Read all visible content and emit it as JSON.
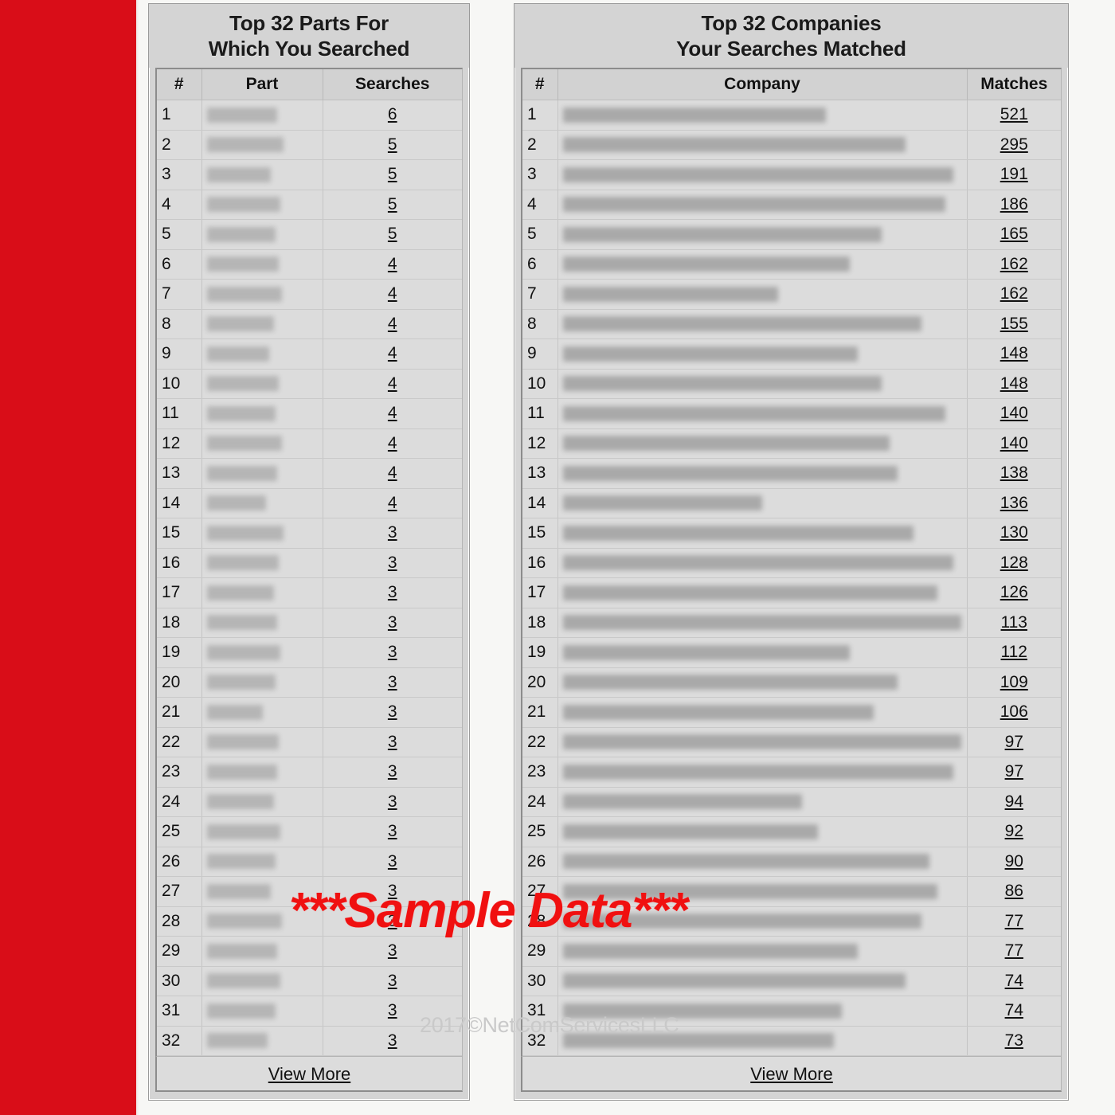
{
  "theme": {
    "rail_color": "#d90d18",
    "panel_bg": "#d4d4d4",
    "table_bg": "#dcdcdc",
    "watermark_color": "#f01010",
    "copyright_color": "#c9c9c9"
  },
  "watermarks": {
    "sample": "***Sample Data***",
    "copyright": "2017©NetComServicesLLC"
  },
  "panels": {
    "parts": {
      "title_line1": "Top 32 Parts For",
      "title_line2": "Which You Searched",
      "columns": [
        "#",
        "Part",
        "Searches"
      ],
      "view_more": "View More",
      "rows": [
        {
          "idx": "1",
          "part": "",
          "searches": "6"
        },
        {
          "idx": "2",
          "part": "",
          "searches": "5"
        },
        {
          "idx": "3",
          "part": "",
          "searches": "5"
        },
        {
          "idx": "4",
          "part": "",
          "searches": "5"
        },
        {
          "idx": "5",
          "part": "",
          "searches": "5"
        },
        {
          "idx": "6",
          "part": "",
          "searches": "4"
        },
        {
          "idx": "7",
          "part": "",
          "searches": "4"
        },
        {
          "idx": "8",
          "part": "",
          "searches": "4"
        },
        {
          "idx": "9",
          "part": "",
          "searches": "4"
        },
        {
          "idx": "10",
          "part": "",
          "searches": "4"
        },
        {
          "idx": "11",
          "part": "",
          "searches": "4"
        },
        {
          "idx": "12",
          "part": "",
          "searches": "4"
        },
        {
          "idx": "13",
          "part": "",
          "searches": "4"
        },
        {
          "idx": "14",
          "part": "",
          "searches": "4"
        },
        {
          "idx": "15",
          "part": "",
          "searches": "3"
        },
        {
          "idx": "16",
          "part": "",
          "searches": "3"
        },
        {
          "idx": "17",
          "part": "",
          "searches": "3"
        },
        {
          "idx": "18",
          "part": "",
          "searches": "3"
        },
        {
          "idx": "19",
          "part": "",
          "searches": "3"
        },
        {
          "idx": "20",
          "part": "",
          "searches": "3"
        },
        {
          "idx": "21",
          "part": "",
          "searches": "3"
        },
        {
          "idx": "22",
          "part": "",
          "searches": "3"
        },
        {
          "idx": "23",
          "part": "",
          "searches": "3"
        },
        {
          "idx": "24",
          "part": "",
          "searches": "3"
        },
        {
          "idx": "25",
          "part": "",
          "searches": "3"
        },
        {
          "idx": "26",
          "part": "",
          "searches": "3"
        },
        {
          "idx": "27",
          "part": "",
          "searches": "3"
        },
        {
          "idx": "28",
          "part": "",
          "searches": "3"
        },
        {
          "idx": "29",
          "part": "",
          "searches": "3"
        },
        {
          "idx": "30",
          "part": "",
          "searches": "3"
        },
        {
          "idx": "31",
          "part": "",
          "searches": "3"
        },
        {
          "idx": "32",
          "part": "",
          "searches": "3"
        }
      ]
    },
    "companies": {
      "title_line1": "Top 32 Companies",
      "title_line2": "Your Searches Matched",
      "columns": [
        "#",
        "Company",
        "Matches"
      ],
      "view_more": "View More",
      "rows": [
        {
          "idx": "1",
          "company": "",
          "matches": "521"
        },
        {
          "idx": "2",
          "company": "",
          "matches": "295"
        },
        {
          "idx": "3",
          "company": "",
          "matches": "191"
        },
        {
          "idx": "4",
          "company": "",
          "matches": "186"
        },
        {
          "idx": "5",
          "company": "",
          "matches": "165"
        },
        {
          "idx": "6",
          "company": "",
          "matches": "162"
        },
        {
          "idx": "7",
          "company": "",
          "matches": "162"
        },
        {
          "idx": "8",
          "company": "",
          "matches": "155"
        },
        {
          "idx": "9",
          "company": "",
          "matches": "148"
        },
        {
          "idx": "10",
          "company": "",
          "matches": "148"
        },
        {
          "idx": "11",
          "company": "",
          "matches": "140"
        },
        {
          "idx": "12",
          "company": "",
          "matches": "140"
        },
        {
          "idx": "13",
          "company": "",
          "matches": "138"
        },
        {
          "idx": "14",
          "company": "",
          "matches": "136"
        },
        {
          "idx": "15",
          "company": "",
          "matches": "130"
        },
        {
          "idx": "16",
          "company": "",
          "matches": "128"
        },
        {
          "idx": "17",
          "company": "",
          "matches": "126"
        },
        {
          "idx": "18",
          "company": "",
          "matches": "113"
        },
        {
          "idx": "19",
          "company": "",
          "matches": "112"
        },
        {
          "idx": "20",
          "company": "",
          "matches": "109"
        },
        {
          "idx": "21",
          "company": "",
          "matches": "106"
        },
        {
          "idx": "22",
          "company": "",
          "matches": "97"
        },
        {
          "idx": "23",
          "company": "",
          "matches": "97"
        },
        {
          "idx": "24",
          "company": "",
          "matches": "94"
        },
        {
          "idx": "25",
          "company": "",
          "matches": "92"
        },
        {
          "idx": "26",
          "company": "",
          "matches": "90"
        },
        {
          "idx": "27",
          "company": "",
          "matches": "86"
        },
        {
          "idx": "28",
          "company": "",
          "matches": "77"
        },
        {
          "idx": "29",
          "company": "",
          "matches": "77"
        },
        {
          "idx": "30",
          "company": "",
          "matches": "74"
        },
        {
          "idx": "31",
          "company": "",
          "matches": "74"
        },
        {
          "idx": "32",
          "company": "",
          "matches": "73"
        }
      ]
    }
  },
  "redaction": {
    "parts_widths": [
      88,
      96,
      80,
      92,
      86,
      90,
      94,
      84,
      78,
      90,
      86,
      94,
      88,
      74,
      96,
      90,
      84,
      88,
      92,
      86,
      70,
      90,
      88,
      84,
      92,
      86,
      80,
      94,
      88,
      92,
      86,
      76
    ],
    "companies_widths": [
      330,
      430,
      490,
      480,
      400,
      360,
      270,
      450,
      370,
      400,
      480,
      410,
      420,
      250,
      440,
      490,
      470,
      500,
      360,
      420,
      390,
      500,
      490,
      300,
      320,
      460,
      470,
      450,
      370,
      430,
      350,
      340
    ]
  }
}
